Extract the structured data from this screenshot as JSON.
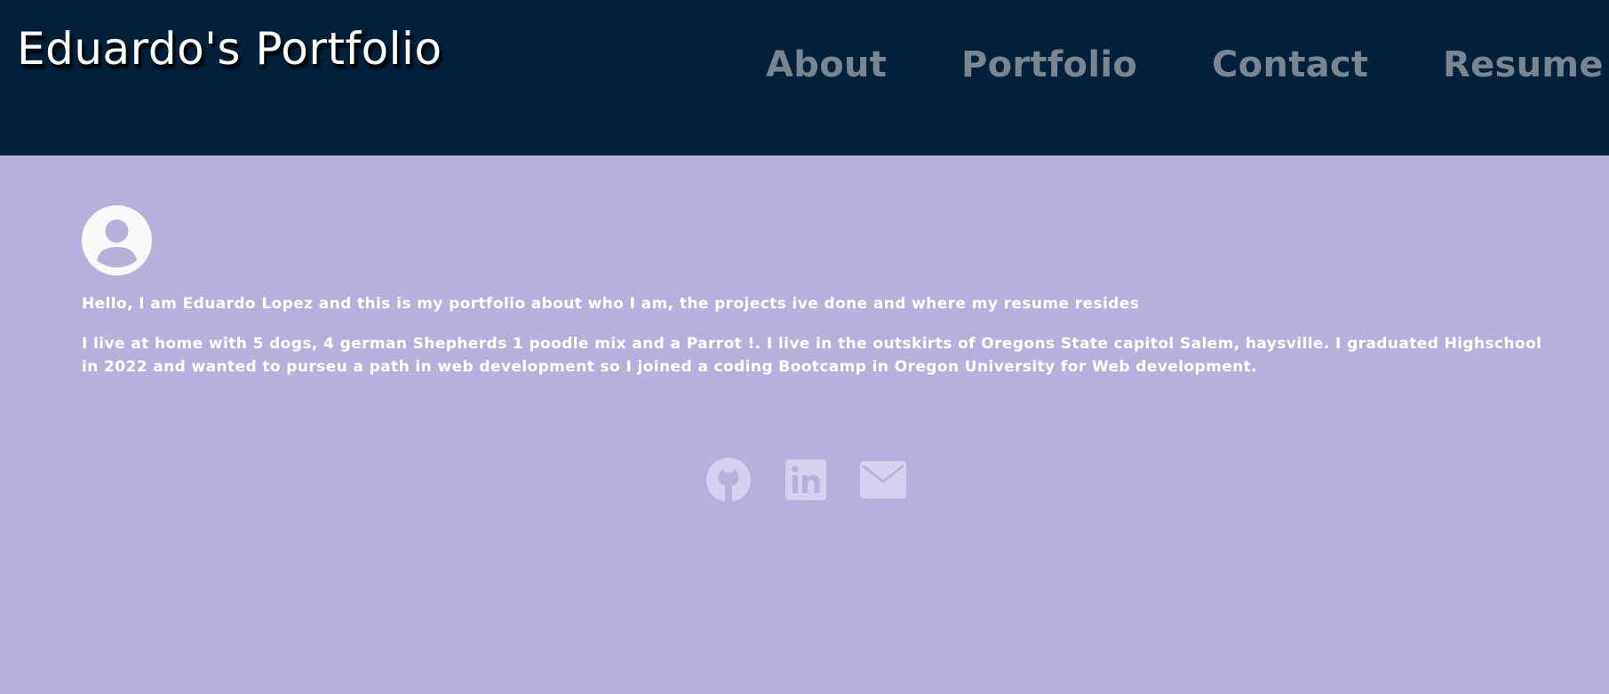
{
  "header": {
    "title": "Eduardo's Portfolio",
    "nav": [
      {
        "label": "About"
      },
      {
        "label": "Portfolio"
      },
      {
        "label": "Contact"
      },
      {
        "label": "Resume"
      }
    ]
  },
  "main": {
    "avatar_icon": "user-circle-icon",
    "intro": "Hello, I am Eduardo Lopez and this is my portfolio about who I am, the projects ive done and where my resume resides",
    "bio": "I live at home with 5 dogs, 4 german Shepherds 1 poodle mix and a Parrot !. I live in the outskirts of Oregons State capitol Salem, haysville. I graduated Highschool in 2022 and wanted to purseu a path in web development so I joined a coding Bootcamp in Oregon University for Web development."
  },
  "social": [
    {
      "icon": "github-icon"
    },
    {
      "icon": "linkedin-icon"
    },
    {
      "icon": "email-icon"
    }
  ],
  "colors": {
    "header_bg": "#03203a",
    "page_bg": "#b4b1dc",
    "nav_text": "#7a8590",
    "social_icon": "#d4d2ee"
  }
}
